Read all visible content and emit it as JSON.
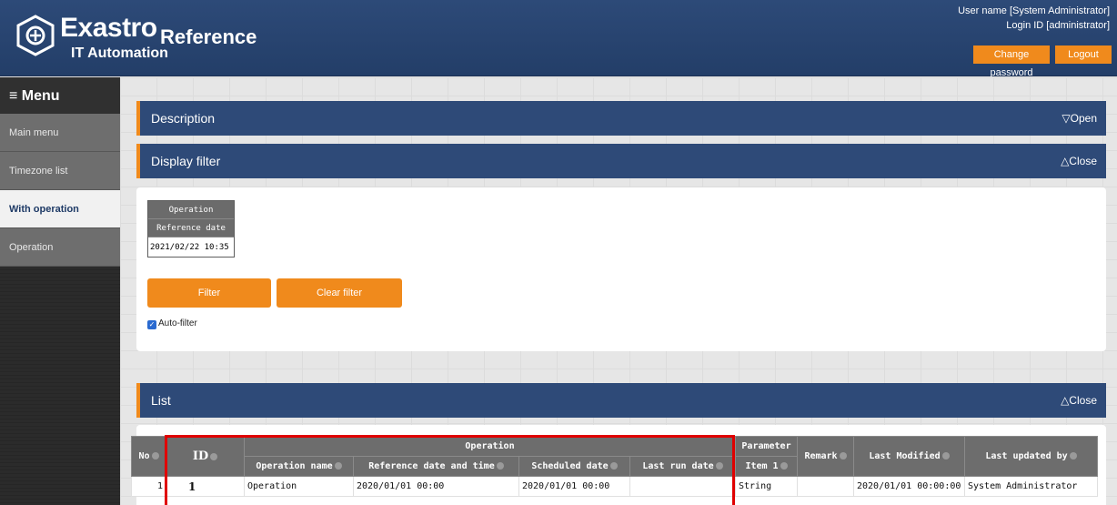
{
  "header": {
    "logo_word": "Exastro",
    "logo_sub": "IT Automation",
    "page_title": "Reference",
    "user_name": "User name [System Administrator]",
    "login_id": "Login ID [administrator]",
    "change_password": "Change password",
    "logout": "Logout"
  },
  "sidebar": {
    "menu_label": "≡ Menu",
    "items": [
      {
        "label": "Main menu"
      },
      {
        "label": "Timezone list"
      },
      {
        "label": "With operation"
      },
      {
        "label": "Operation"
      }
    ]
  },
  "description_bar": {
    "title": "Description",
    "toggle": "▽Open"
  },
  "filter_bar": {
    "title": "Display filter",
    "toggle": "△Close"
  },
  "filter": {
    "group_header": "Operation",
    "field_header": "Reference date",
    "field_value": "2021/02/22 10:35",
    "filter_button": "Filter",
    "clear_button": "Clear filter",
    "auto_filter_label": "Auto-filter",
    "auto_filter_checked": true
  },
  "list_bar": {
    "title": "List",
    "toggle": "△Close"
  },
  "table": {
    "headers": {
      "no": "No",
      "id": "ID",
      "operation_group": "Operation",
      "parameter": "Parameter",
      "remark": "Remark",
      "last_modified": "Last Modified",
      "last_updated_by": "Last updated by",
      "operation_name": "Operation name",
      "reference_datetime": "Reference date and time",
      "scheduled_date": "Scheduled date",
      "last_run_date": "Last run date",
      "item1": "Item 1"
    },
    "rows": [
      {
        "no": "1",
        "id": "1",
        "operation_name": "Operation",
        "reference_datetime": "2020/01/01 00:00",
        "scheduled_date": "2020/01/01 00:00",
        "last_run_date": "",
        "item1": "String",
        "remark": "",
        "last_modified": "2020/01/01 00:00:00",
        "last_updated_by": "System Administrator"
      }
    ]
  },
  "colors": {
    "header_bg": "#2d4a78",
    "accent_orange": "#f08a1c",
    "highlight_red": "#e00000"
  }
}
